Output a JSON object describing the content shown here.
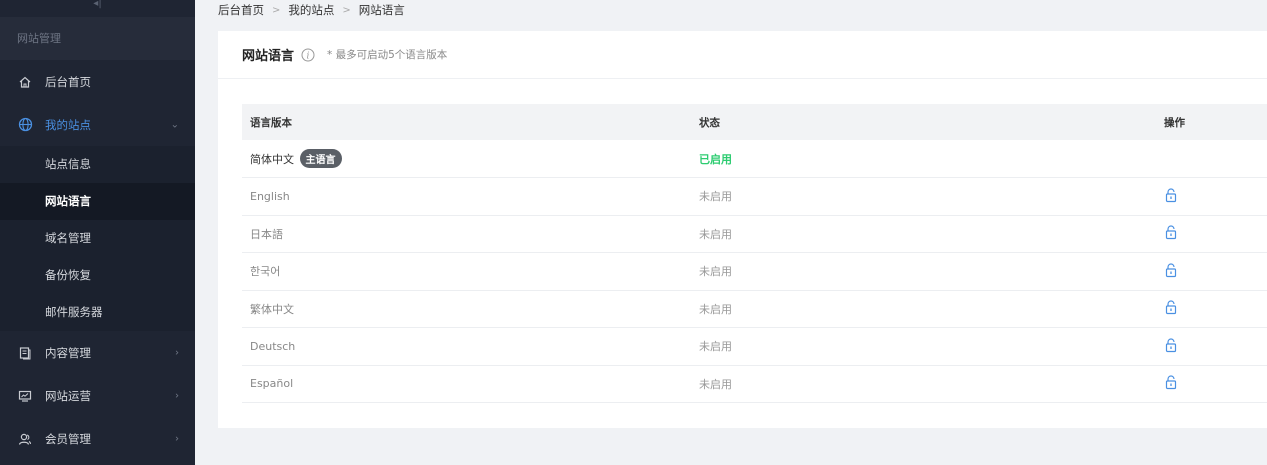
{
  "sidebar": {
    "collapse_glyph": "◂|",
    "section_title": "网站管理",
    "items": [
      {
        "label": "后台首页",
        "icon": "home-icon"
      },
      {
        "label": "我的站点",
        "icon": "globe-icon",
        "expanded": true
      },
      {
        "label": "内容管理",
        "icon": "content-icon"
      },
      {
        "label": "网站运营",
        "icon": "monitor-icon"
      },
      {
        "label": "会员管理",
        "icon": "users-icon"
      }
    ],
    "sub_items": [
      {
        "label": "站点信息"
      },
      {
        "label": "网站语言",
        "selected": true
      },
      {
        "label": "域名管理"
      },
      {
        "label": "备份恢复"
      },
      {
        "label": "邮件服务器"
      }
    ],
    "accent_color": "#4a90e2"
  },
  "breadcrumb": {
    "items": [
      "后台首页",
      "我的站点",
      "网站语言"
    ]
  },
  "card": {
    "title": "网站语言",
    "hint": "* 最多可启动5个语言版本"
  },
  "table": {
    "headers": [
      "语言版本",
      "状态",
      "操作"
    ],
    "rows": [
      {
        "name": "简体中文",
        "badge": "主语言",
        "status": "已启用"
      },
      {
        "name": "English",
        "status": "未启用"
      },
      {
        "name": "日本語",
        "status": "未启用"
      },
      {
        "name": "한국어",
        "status": "未启用"
      },
      {
        "name": "繁体中文",
        "status": "未启用"
      },
      {
        "name": "Deutsch",
        "status": "未启用"
      },
      {
        "name": "Español",
        "status": "未启用"
      }
    ],
    "status_on_color": "#2ecc71",
    "lock_icon": "lock-icon"
  }
}
